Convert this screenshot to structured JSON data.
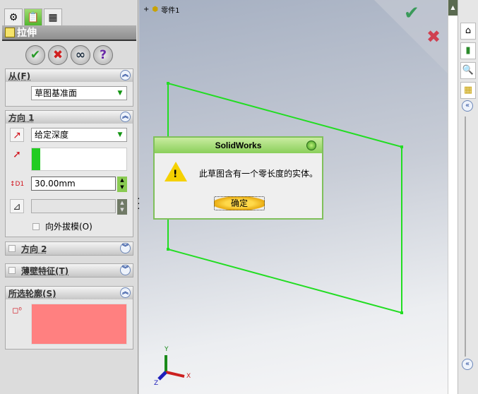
{
  "property_manager": {
    "tabs": [
      "feature-manager",
      "property-manager",
      "configuration-manager"
    ],
    "title": "拉伸",
    "actions": [
      "ok",
      "cancel",
      "preview",
      "help"
    ],
    "from": {
      "label": "从(F)",
      "value": "草图基准面"
    },
    "direction1": {
      "label": "方向 1",
      "end_condition": "给定深度",
      "depth": "30.00mm",
      "draft_label": "向外拔模(O)"
    },
    "direction2": {
      "label": "方向 2"
    },
    "thin_feature": {
      "label": "薄壁特征(T)"
    },
    "selected_contours": {
      "label": "所选轮廓(S)",
      "color": "#ff8080"
    }
  },
  "viewport": {
    "tree_root": "零件1",
    "axes": {
      "x": "X",
      "y": "Y",
      "z": "Z"
    },
    "sketch_color": "#22dd22"
  },
  "dialog": {
    "title": "SolidWorks",
    "message": "此草图含有一个零长度的实体。",
    "ok_label": "确定"
  }
}
